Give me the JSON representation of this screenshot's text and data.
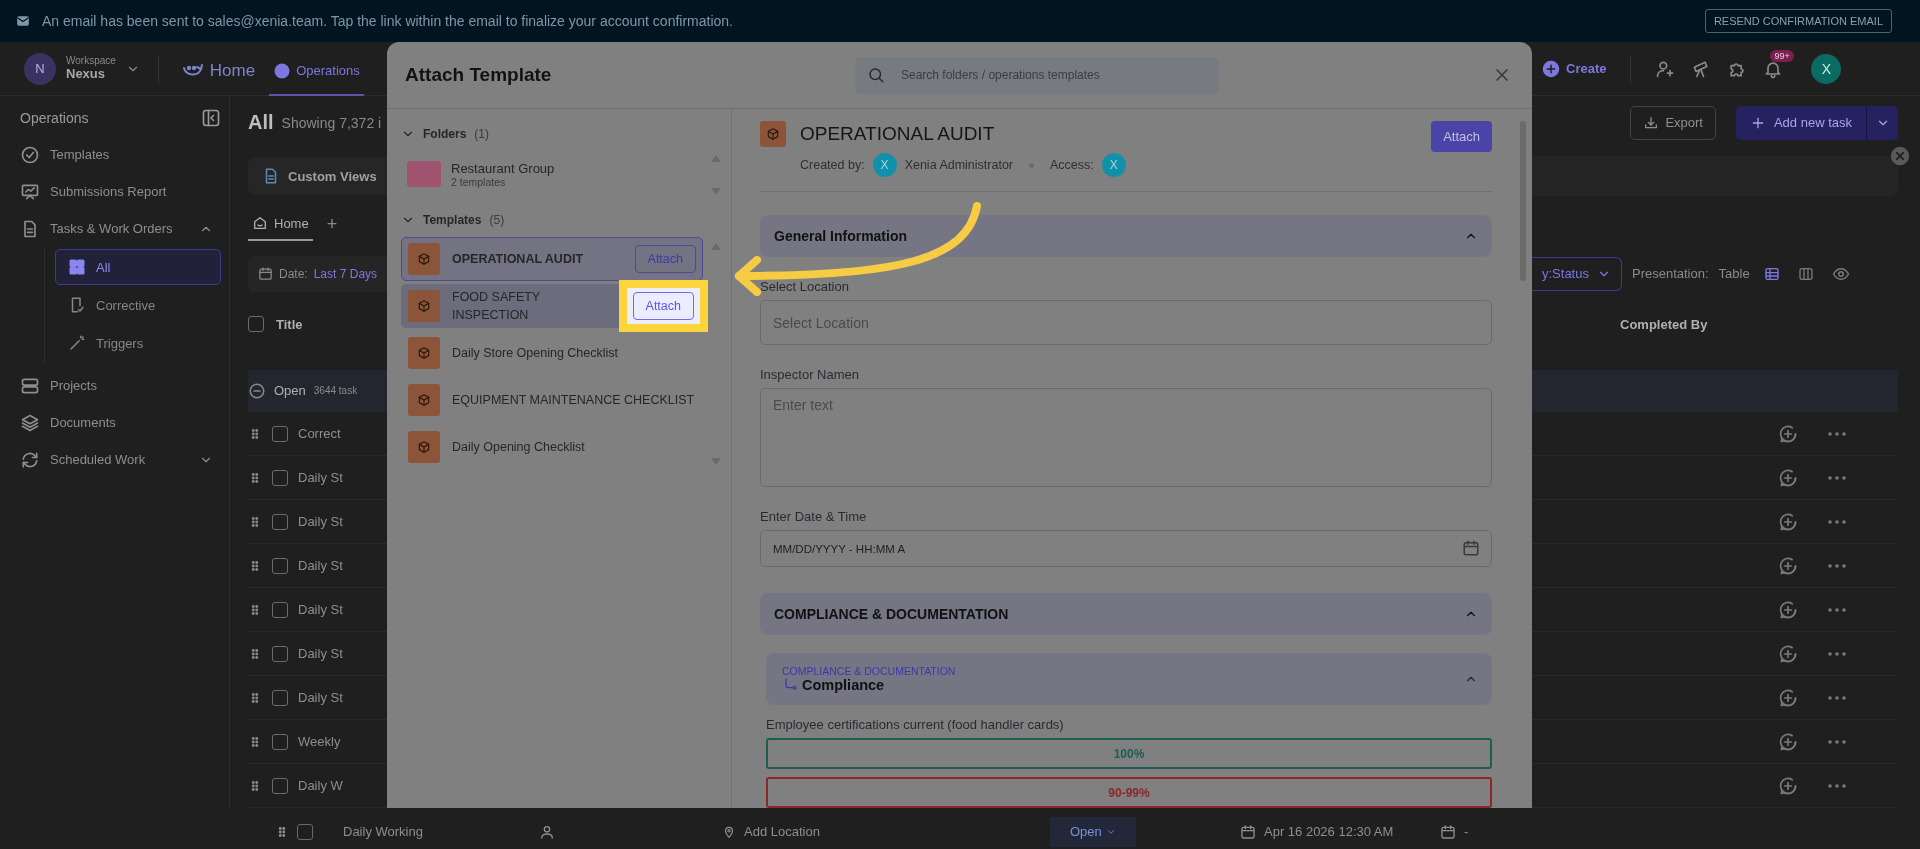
{
  "banner": {
    "message": "An email has been sent to sales@xenia.team. Tap the link within the email to finalize your account confirmation.",
    "button": "RESEND CONFIRMATION EMAIL"
  },
  "topbar": {
    "workspace_avatar": "N",
    "workspace_label": "Workspace",
    "workspace_name": "Nexus",
    "nav": [
      {
        "label": "Home",
        "selected": false
      },
      {
        "label": "Operations",
        "selected": true
      }
    ],
    "create": "Create",
    "notification_badge": "99+",
    "user_avatar": "X"
  },
  "sidebar": {
    "title": "Operations",
    "items": [
      {
        "label": "Templates",
        "selected": false
      },
      {
        "label": "Submissions Report",
        "selected": false
      },
      {
        "label": "Tasks & Work Orders",
        "selected": false,
        "expanded": true,
        "children": [
          {
            "label": "All",
            "selected": true
          },
          {
            "label": "Corrective",
            "selected": false
          },
          {
            "label": "Triggers",
            "selected": false
          }
        ]
      },
      {
        "label": "Projects",
        "selected": false
      },
      {
        "label": "Documents",
        "selected": false
      },
      {
        "label": "Scheduled Work",
        "selected": false,
        "expanded": false
      }
    ]
  },
  "main": {
    "title": "All",
    "count": "Showing 7,372 i",
    "custom_views": "Custom Views",
    "tabs": [
      {
        "label": "Home",
        "selected": true
      }
    ],
    "add_tab": "+",
    "date_label": "Date:",
    "date_value": "Last 7 Days",
    "export": "Export",
    "add_task": "Add new task",
    "group_by": "y:Status",
    "presentation_label": "Presentation:",
    "presentation_value": "Table",
    "select_all_checked": false,
    "columns": [
      "Title",
      "Completed By"
    ],
    "group": {
      "label": "Open",
      "count": "3644 task"
    },
    "rows": [
      {
        "title": "Correct",
        "checked": false
      },
      {
        "title": "Daily St",
        "checked": false
      },
      {
        "title": "Daily St",
        "checked": false
      },
      {
        "title": "Daily St",
        "checked": false
      },
      {
        "title": "Daily St",
        "checked": false
      },
      {
        "title": "Daily St",
        "checked": false
      },
      {
        "title": "Daily St",
        "checked": false
      },
      {
        "title": "Weekly",
        "checked": false
      },
      {
        "title": "Daily W",
        "checked": false
      }
    ],
    "last_row": {
      "title": "Daily Working",
      "checked": false,
      "location": "Add Location",
      "status": "Open",
      "date": "Apr 16 2026 12:30 AM",
      "due": "-"
    }
  },
  "modal": {
    "title": "Attach Template",
    "search_placeholder": "Search folders / operations templates",
    "folders": {
      "label": "Folders",
      "count": "(1)",
      "expanded": true,
      "items": [
        {
          "name": "Restaurant Group",
          "subtitle": "2 templates"
        }
      ]
    },
    "templates": {
      "label": "Templates",
      "count": "(5)",
      "expanded": true,
      "items": [
        {
          "name": "OPERATIONAL AUDIT",
          "selected": true,
          "hovered": false,
          "attach": "Attach",
          "spotlight": false
        },
        {
          "name": "FOOD SAFETY INSPECTION",
          "selected": false,
          "hovered": true,
          "attach": "Attach",
          "spotlight": true
        },
        {
          "name": "Daily Store Opening Checklist",
          "selected": false,
          "hovered": false,
          "spotlight": false
        },
        {
          "name": "EQUIPMENT MAINTENANCE CHECKLIST",
          "selected": false,
          "hovered": false,
          "spotlight": false
        },
        {
          "name": "Daily Opening Checklist",
          "selected": false,
          "hovered": false,
          "spotlight": false
        }
      ]
    },
    "detail": {
      "title": "OPERATIONAL AUDIT",
      "attach": "Attach",
      "created_by_label": "Created by:",
      "creator_avatar": "X",
      "creator": "Xenia Administrator",
      "access_label": "Access:",
      "access_avatar": "X",
      "sections": [
        {
          "title": "General Information",
          "expanded": true,
          "fields": [
            {
              "kind": "select",
              "label": "Select Location",
              "placeholder": "Select Location"
            },
            {
              "kind": "textarea",
              "label": "Inspector Namen",
              "placeholder": "Enter text"
            },
            {
              "kind": "datetime",
              "label": "Enter Date & Time",
              "placeholder": "MM/DD/YYYY - HH:MM A"
            }
          ]
        },
        {
          "title": "COMPLIANCE & DOCUMENTATION",
          "expanded": true,
          "subsections": [
            {
              "breadcrumb": "COMPLIANCE & DOCUMENTATION",
              "title": "Compliance",
              "expanded": true,
              "questions": [
                {
                  "label": "Employee certifications current (food handler cards)",
                  "options": [
                    {
                      "label": "100%",
                      "color": "#1c5e52"
                    },
                    {
                      "label": "90-99%",
                      "color": "#8e2626"
                    }
                  ]
                }
              ]
            }
          ]
        }
      ]
    }
  }
}
